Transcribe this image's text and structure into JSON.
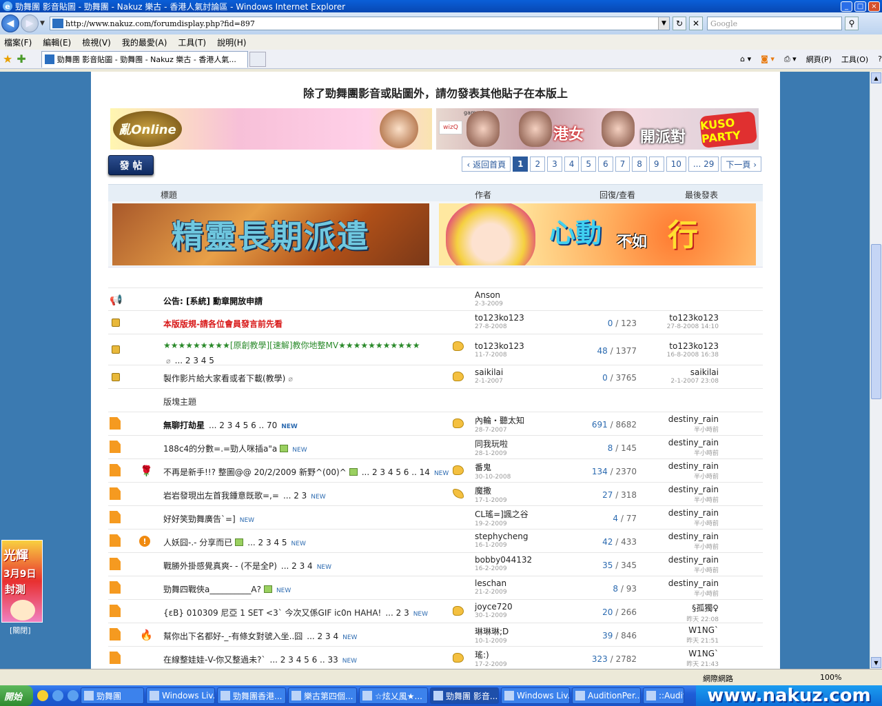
{
  "window": {
    "title": "勁舞團 影音貼圖 - 勁舞團 - Nakuz 樂古 - 香港人氣討論區 - Windows Internet Explorer",
    "url": "http://www.nakuz.com/forumdisplay.php?fid=897",
    "search_placeholder": "Google",
    "tab_label": "勁舞團 影音貼圖 - 勁舞團 - Nakuz 樂古 - 香港人氣...",
    "menu": [
      "檔案(F)",
      "編輯(E)",
      "檢視(V)",
      "我的最愛(A)",
      "工具(T)",
      "說明(H)"
    ],
    "tools": [
      "網頁(P)",
      "工具(O)"
    ]
  },
  "page": {
    "notice": "除了勁舞團影音或貼圖外，請勿發表其他貼子在本版上",
    "banner1_logo": "亂Online",
    "banner2": {
      "brand": "gamania",
      "wiz": "wizQ",
      "t1": "港女",
      "t2": "開派對",
      "kuso": "KUSO PARTY"
    },
    "post_button": "發 帖",
    "pager": {
      "back": "‹ 返回首頁",
      "pages": [
        "1",
        "2",
        "3",
        "4",
        "5",
        "6",
        "7",
        "8",
        "9",
        "10",
        "... 29"
      ],
      "next": "下一頁 ›"
    },
    "headers": {
      "subject": "標題",
      "author": "作者",
      "replies": "回復/查看",
      "last": "最後發表"
    },
    "ad1_text": "精靈長期派遣",
    "ad2": {
      "t1": "心動",
      "t2": "不如",
      "t3": "行"
    },
    "section_label": "版塊主題"
  },
  "threads": [
    {
      "subject": "公告: [系統] 勳章開放申請",
      "author": "Anson",
      "date": "2-3-2009",
      "replies": "",
      "views": "",
      "last_user": "",
      "last_time": ""
    },
    {
      "subject": "本版版規-請各位會員發言前先看",
      "author": "to123ko123",
      "date": "27-8-2008",
      "replies": "0",
      "views": "123",
      "last_user": "to123ko123",
      "last_time": "27-8-2008 14:10"
    },
    {
      "subject": "★★★★★★★★★[原創教學][速解]教你地整MV★★★★★★★★★★★",
      "pages": "... 2 3 4 5",
      "author": "to123ko123",
      "date": "11-7-2008",
      "replies": "48",
      "views": "1377",
      "last_user": "to123ko123",
      "last_time": "16-8-2008 16:38"
    },
    {
      "subject": "製作影片給大家看或者下載(教學)",
      "author": "saikilai",
      "date": "2-1-2007",
      "replies": "0",
      "views": "3765",
      "last_user": "saikilai",
      "last_time": "2-1-2007 23:08"
    },
    {
      "subject": "無聊打劫星",
      "pages": "... 2 3 4 5 6 .. 70",
      "new": "NEW",
      "author": "內輪・聽太知",
      "date": "28-7-2007",
      "replies": "691",
      "views": "8682",
      "last_user": "destiny_rain",
      "last_time": "半小時前"
    },
    {
      "subject": "188c4的分數=.=勁人咪插a\"a",
      "new": "NEW",
      "author": "同我玩啦",
      "date": "28-1-2009",
      "replies": "8",
      "views": "145",
      "last_user": "destiny_rain",
      "last_time": "半小時前"
    },
    {
      "subject": "不再是新手!!? 整圖@@ 20/2/2009 新野^(00)^",
      "pages": "... 2 3 4 5 6 .. 14",
      "new": "NEW",
      "author": "番鬼",
      "date": "30-10-2008",
      "replies": "134",
      "views": "2370",
      "last_user": "destiny_rain",
      "last_time": "半小時前"
    },
    {
      "subject": "岩岩發現出左首我鍾意既歌=,=",
      "pages": "... 2 3",
      "new": "NEW",
      "author": "魔撒",
      "date": "17-1-2009",
      "replies": "27",
      "views": "318",
      "last_user": "destiny_rain",
      "last_time": "半小時前"
    },
    {
      "subject": "好好笑勁舞廣告`=]",
      "new": "NEW",
      "author": "CL瑤=]諷之谷",
      "date": "19-2-2009",
      "replies": "4",
      "views": "77",
      "last_user": "destiny_rain",
      "last_time": "半小時前"
    },
    {
      "subject": "人妖囧-.- 分享而已",
      "pages": "... 2 3 4 5",
      "new": "NEW",
      "author": "stephycheng",
      "date": "16-1-2009",
      "replies": "42",
      "views": "433",
      "last_user": "destiny_rain",
      "last_time": "半小時前"
    },
    {
      "subject": "戰勝外掛感覺真爽- - (不是全P)",
      "pages": "... 2 3 4",
      "new": "NEW",
      "author": "bobby044132",
      "date": "16-2-2009",
      "replies": "35",
      "views": "345",
      "last_user": "destiny_rain",
      "last_time": "半小時前"
    },
    {
      "subject": "勁舞四戰俠a__________A?",
      "new": "NEW",
      "author": "leschan",
      "date": "21-2-2009",
      "replies": "8",
      "views": "93",
      "last_user": "destiny_rain",
      "last_time": "半小時前"
    },
    {
      "subject": "{εВ} 010309 尼亞 1 SET <3` 今次又係GIF ic0n HAHA!",
      "pages": "... 2 3",
      "new": "NEW",
      "author": "joyce720",
      "date": "30-1-2009",
      "replies": "20",
      "views": "266",
      "last_user": "§孤獨♀",
      "last_time": "昨天 22:08"
    },
    {
      "subject": "幫你出下名都好-_-有條女對號入坐..囧",
      "pages": "... 2 3 4",
      "new": "NEW",
      "author": "琳琳琳;D",
      "date": "10-1-2009",
      "replies": "39",
      "views": "846",
      "last_user": "W1NG`",
      "last_time": "昨天 21:51"
    },
    {
      "subject": "在線整娃娃-V-你又整過未?`",
      "pages": "... 2 3 4 5 6 .. 33",
      "new": "NEW",
      "author": "瑤:)",
      "date": "17-2-2009",
      "replies": "323",
      "views": "2782",
      "last_user": "W1NG`",
      "last_time": "昨天 21:43"
    }
  ],
  "side_ad": {
    "t1": "光輝",
    "t2": "3月9日",
    "t3": "封測",
    "close": "[關閉]"
  },
  "status": {
    "zone": "網際網路",
    "zoom": "100%"
  },
  "taskbar": {
    "start": "開始",
    "items": [
      "勁舞團",
      "Windows Liv...",
      "勁舞團香港...",
      "樂古第四個...",
      "☆炫乂風★...",
      "勁舞團 影音...",
      "Windows Liv...",
      "AuditionPer...",
      "::Auditi..."
    ],
    "tray_text": "www.nakuz.com"
  }
}
